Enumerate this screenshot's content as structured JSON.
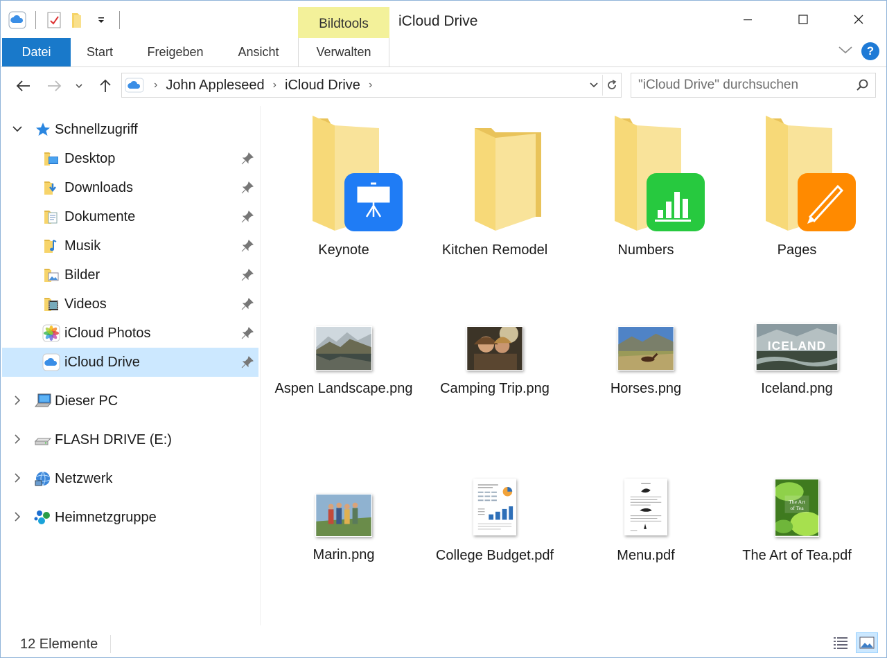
{
  "window": {
    "title": "iCloud Drive",
    "context_tab": "Bildtools",
    "accent": "#1979ca",
    "context_color": "#f3f19a"
  },
  "ribbon": {
    "tabs": [
      "Datei",
      "Start",
      "Freigeben",
      "Ansicht",
      "Verwalten"
    ],
    "help_label": "?"
  },
  "address": {
    "crumbs": [
      "John Appleseed",
      "iCloud Drive"
    ],
    "search_placeholder": "\"iCloud Drive\" durchsuchen"
  },
  "sidebar": {
    "quick_access": "Schnellzugriff",
    "pinned": [
      {
        "label": "Desktop",
        "icon": "desktop-folder-icon"
      },
      {
        "label": "Downloads",
        "icon": "downloads-folder-icon"
      },
      {
        "label": "Dokumente",
        "icon": "documents-folder-icon"
      },
      {
        "label": "Musik",
        "icon": "music-folder-icon"
      },
      {
        "label": "Bilder",
        "icon": "pictures-folder-icon"
      },
      {
        "label": "Videos",
        "icon": "videos-folder-icon"
      },
      {
        "label": "iCloud Photos",
        "icon": "photos-icon"
      },
      {
        "label": "iCloud Drive",
        "icon": "icloud-icon",
        "selected": true
      }
    ],
    "roots": [
      {
        "label": "Dieser PC",
        "icon": "computer-icon"
      },
      {
        "label": "FLASH DRIVE (E:)",
        "icon": "drive-icon"
      },
      {
        "label": "Netzwerk",
        "icon": "network-icon"
      },
      {
        "label": "Heimnetzgruppe",
        "icon": "homegroup-icon"
      }
    ]
  },
  "items": [
    {
      "name": "Keynote",
      "kind": "app-folder",
      "badge_color": "#1f7cf5"
    },
    {
      "name": "Kitchen Remodel",
      "kind": "folder"
    },
    {
      "name": "Numbers",
      "kind": "app-folder",
      "badge_color": "#27c93f"
    },
    {
      "name": "Pages",
      "kind": "app-folder",
      "badge_color": "#ff8a00"
    },
    {
      "name": "Aspen Landscape.png",
      "kind": "image"
    },
    {
      "name": "Camping Trip.png",
      "kind": "image"
    },
    {
      "name": "Horses.png",
      "kind": "image"
    },
    {
      "name": "Iceland.png",
      "kind": "image",
      "overlay": "ICELAND"
    },
    {
      "name": "Marin.png",
      "kind": "image"
    },
    {
      "name": "College Budget.pdf",
      "kind": "pdf"
    },
    {
      "name": "Menu.pdf",
      "kind": "pdf"
    },
    {
      "name": "The Art of Tea.pdf",
      "kind": "pdf",
      "overlay": "The Art of Tea"
    }
  ],
  "status": {
    "count": "12 Elemente"
  }
}
